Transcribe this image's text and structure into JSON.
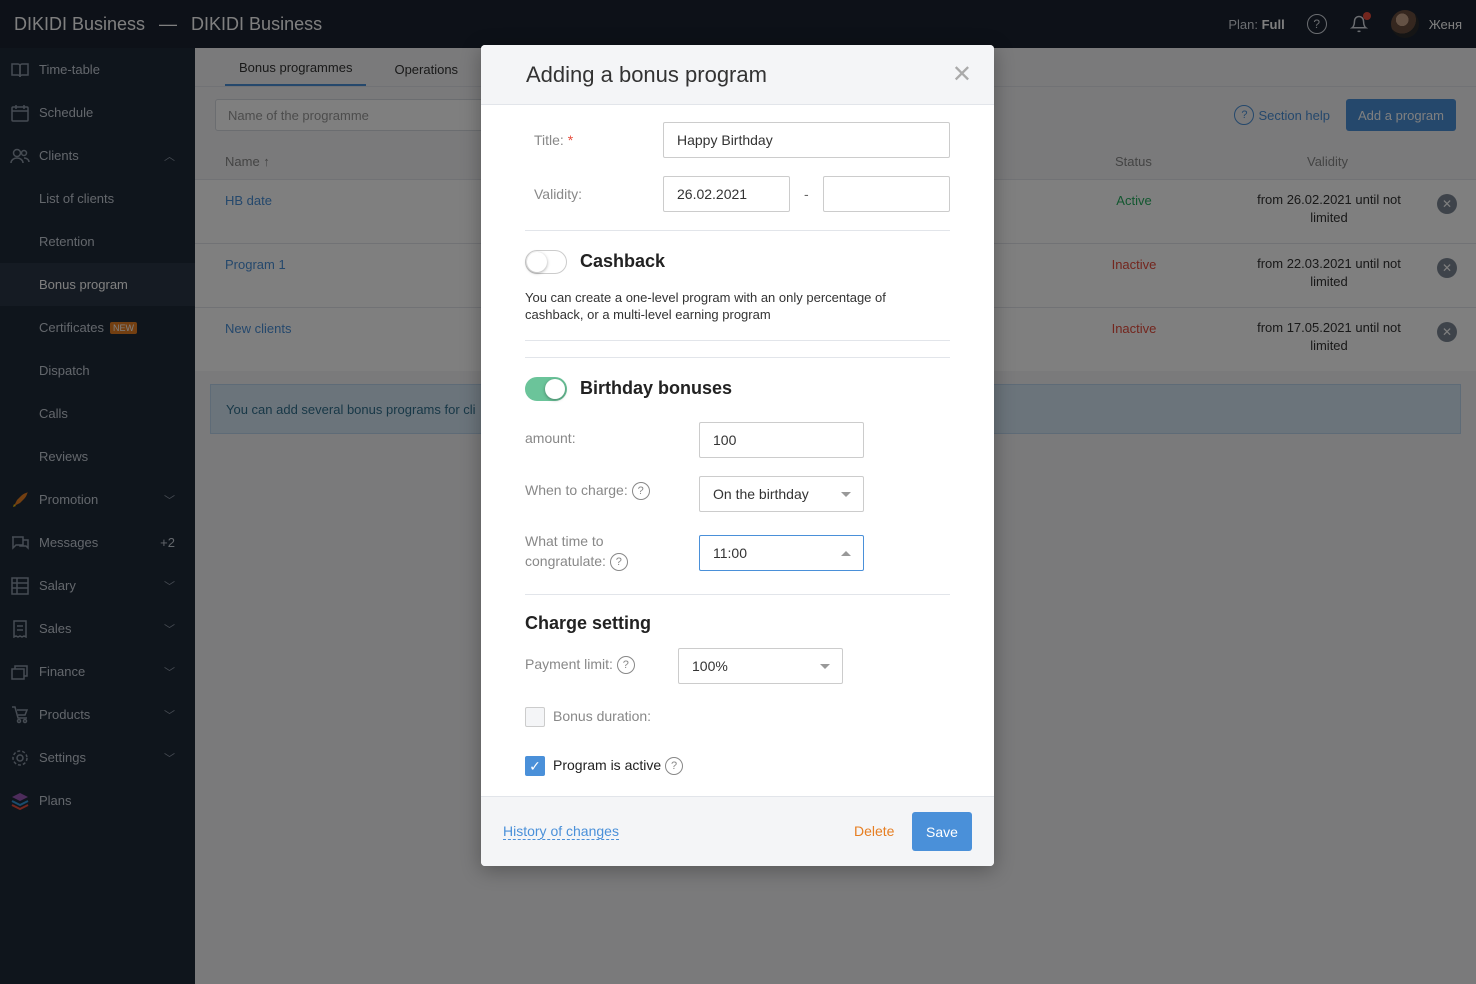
{
  "topbar": {
    "brand_left": "DIKIDI Business",
    "brand_dash": "—",
    "brand_right": "DIKIDI Business",
    "plan_label": "Plan:",
    "plan_value": "Full",
    "user_name": "Женя"
  },
  "sidebar": {
    "items": [
      {
        "label": "Time-table"
      },
      {
        "label": "Schedule"
      },
      {
        "label": "Clients"
      },
      {
        "label": "List of clients"
      },
      {
        "label": "Retention"
      },
      {
        "label": "Bonus program"
      },
      {
        "label": "Certificates",
        "badge": "NEW"
      },
      {
        "label": "Dispatch"
      },
      {
        "label": "Calls"
      },
      {
        "label": "Reviews"
      },
      {
        "label": "Promotion"
      },
      {
        "label": "Messages",
        "count": "+2"
      },
      {
        "label": "Salary"
      },
      {
        "label": "Sales"
      },
      {
        "label": "Finance"
      },
      {
        "label": "Products"
      },
      {
        "label": "Settings"
      },
      {
        "label": "Plans"
      }
    ]
  },
  "main": {
    "tabs": [
      {
        "label": "Bonus programmes"
      },
      {
        "label": "Operations"
      }
    ],
    "search_placeholder": "Name of the programme",
    "section_help": "Section help",
    "add_button": "Add a program",
    "columns": {
      "name": "Name ↑",
      "status": "Status",
      "validity": "Validity"
    },
    "rows": [
      {
        "name": "HB date",
        "status": "Active",
        "validity": "from 26.02.2021 until not limited"
      },
      {
        "name": "Program 1",
        "status": "Inactive",
        "validity": "from 22.03.2021 until not limited"
      },
      {
        "name": "New clients",
        "status": "Inactive",
        "validity": "from 17.05.2021 until not limited"
      }
    ],
    "info": "You can add several bonus programs for cli"
  },
  "modal": {
    "title": "Adding a bonus program",
    "title_label": "Title:",
    "required_mark": "*",
    "title_value": "Happy Birthday",
    "validity_label": "Validity:",
    "validity_from": "26.02.2021",
    "validity_sep": "-",
    "validity_to": "",
    "cashback": {
      "title": "Cashback",
      "enabled": false,
      "description": "You can create a one-level program with an only percentage of cashback, or a multi-level earning program"
    },
    "birthday": {
      "title": "Birthday bonuses",
      "enabled": true,
      "amount_label": "amount:",
      "amount_value": "100",
      "when_label": "When to charge:",
      "when_value": "On the birthday",
      "time_label_1": "What time to",
      "time_label_2": "congratulate:",
      "time_value": "11:00"
    },
    "charge": {
      "title": "Charge setting",
      "payment_limit_label": "Payment limit:",
      "payment_limit_value": "100%",
      "bonus_duration_label": "Bonus duration:",
      "program_active_label": "Program is active"
    },
    "footer": {
      "history": "History of changes",
      "delete": "Delete",
      "save": "Save"
    }
  },
  "colors": {
    "accent": "#4a90d9",
    "active": "#27ae60",
    "inactive": "#e74c3c",
    "toggle_on": "#6bc49a"
  }
}
